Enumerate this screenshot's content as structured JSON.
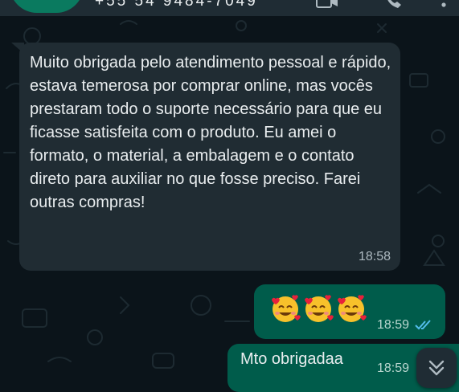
{
  "header": {
    "contact_number": "+55 54 9484-7049",
    "avatar_glyph": "***",
    "icons": [
      "video-call-icon",
      "call-icon",
      "menu-icon"
    ]
  },
  "messages": [
    {
      "direction": "incoming",
      "text": "Muito obrigada pelo atendimento pessoal e rápido, estava temerosa por comprar online, mas vocês prestaram todo o suporte necessário para que eu ficasse satisfeita com o produto. Eu amei o formato, o material, a embalagem e o contato direto para auxiliar no que fosse preciso. Farei outras compras!",
      "time": "18:58"
    },
    {
      "direction": "outgoing",
      "emoji": [
        "smiling-face-with-hearts",
        "smiling-face-with-hearts",
        "smiling-face-with-hearts"
      ],
      "time": "18:59",
      "status": "read"
    },
    {
      "direction": "outgoing",
      "text": "Mto obrigadaa",
      "time": "18:59"
    }
  ],
  "colors": {
    "background": "#0b141a",
    "incoming_bubble": "#202c33",
    "outgoing_bubble": "#005c4b",
    "read_check": "#53bdeb"
  },
  "scroll_button": {
    "icon": "double-chevron-down-icon"
  }
}
